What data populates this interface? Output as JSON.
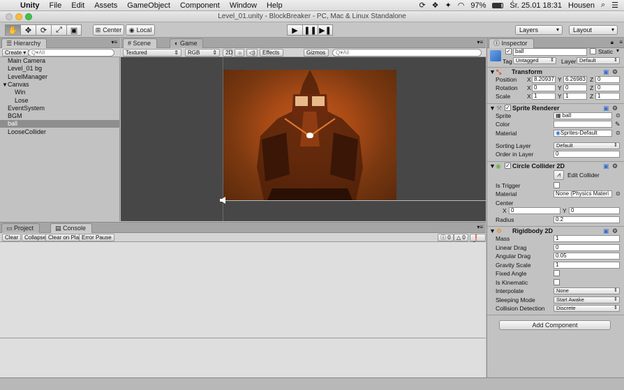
{
  "menubar": {
    "app": "Unity",
    "items": [
      "File",
      "Edit",
      "Assets",
      "GameObject",
      "Component",
      "Window",
      "Help"
    ],
    "battery": "97%",
    "clock": "Śr. 25.01  18:31",
    "user": "Housen"
  },
  "window": {
    "title": "Level_01.unity - BlockBreaker - PC, Mac & Linux Standalone"
  },
  "toolbar": {
    "pivot": "Center",
    "space": "Local",
    "layers": "Layers",
    "layout": "Layout"
  },
  "hierarchy": {
    "tab": "Hierarchy",
    "create": "Create",
    "search_placeholder": "Q▾All",
    "items": [
      {
        "label": "Main Camera",
        "indent": 0
      },
      {
        "label": "Level_01 bg",
        "indent": 0
      },
      {
        "label": "LevelManager",
        "indent": 0
      },
      {
        "label": "Canvas",
        "indent": 0,
        "expand": "▼"
      },
      {
        "label": "Win",
        "indent": 1
      },
      {
        "label": "Lose",
        "indent": 1
      },
      {
        "label": "EventSystem",
        "indent": 0
      },
      {
        "label": "BGM",
        "indent": 0
      },
      {
        "label": "ball",
        "indent": 0,
        "selected": true
      },
      {
        "label": "LooseCollider",
        "indent": 0
      }
    ]
  },
  "scene": {
    "tabs": [
      "Scene",
      "Game"
    ],
    "shading": "Textured",
    "mode": "RGB",
    "two_d": "2D",
    "effects": "Effects",
    "gizmos": "Gizmos",
    "search_placeholder": "Q▾All"
  },
  "console": {
    "tabs": [
      "Project",
      "Console"
    ],
    "buttons": [
      "Clear",
      "Collapse",
      "Clear on Play",
      "Error Pause"
    ],
    "counts": [
      "0",
      "0",
      "0"
    ]
  },
  "inspector": {
    "tab": "Inspector",
    "name": "ball",
    "static": "Static",
    "tag_label": "Tag",
    "tag": "Untagged",
    "layer_label": "Layer",
    "layer": "Default",
    "transform": {
      "title": "Transform",
      "position_label": "Position",
      "rotation_label": "Rotation",
      "scale_label": "Scale",
      "position": [
        "8.20937",
        "6.26983",
        "0"
      ],
      "rotation": [
        "0",
        "0",
        "0"
      ],
      "scale": [
        "1",
        "1",
        "1"
      ]
    },
    "sprite_renderer": {
      "title": "Sprite Renderer",
      "sprite_label": "Sprite",
      "sprite": "ball",
      "color_label": "Color",
      "material_label": "Material",
      "material": "Sprites-Default",
      "sorting_label": "Sorting Layer",
      "sorting": "Default",
      "order_label": "Order in Layer",
      "order": "0"
    },
    "circle_collider": {
      "title": "Circle Collider 2D",
      "edit": "Edit Collider",
      "trigger_label": "Is Trigger",
      "material_label": "Material",
      "material": "None (Physics Materi",
      "center_label": "Center",
      "cx": "0",
      "cy": "0",
      "radius_label": "Radius",
      "radius": "0.2"
    },
    "rigidbody": {
      "title": "Rigidbody 2D",
      "mass_label": "Mass",
      "mass": "1",
      "linear_label": "Linear Drag",
      "linear": "0",
      "angular_label": "Angular Drag",
      "angular": "0.05",
      "gravity_label": "Gravity Scale",
      "gravity": "1",
      "fixed_label": "Fixed Angle",
      "kinematic_label": "Is Kinematic",
      "interp_label": "Interpolate",
      "interp": "None",
      "sleep_label": "Sleeping Mode",
      "sleep": "Start Awake",
      "collision_label": "Collision Detection",
      "collision": "Discrete"
    },
    "add_component": "Add Component"
  }
}
